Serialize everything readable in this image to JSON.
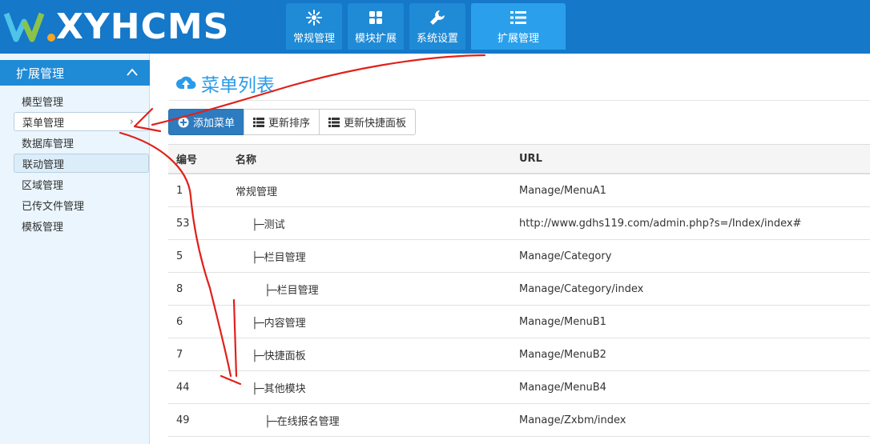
{
  "logo": {
    "text": "XYHCMS"
  },
  "nav": {
    "items": [
      {
        "label": "常规管理",
        "icon": "gear-icon"
      },
      {
        "label": "模块扩展",
        "icon": "grid-icon"
      },
      {
        "label": "系统设置",
        "icon": "wrench-icon"
      },
      {
        "label": "扩展管理",
        "icon": "list-icon"
      }
    ]
  },
  "sidebar": {
    "header": "扩展管理",
    "items": [
      {
        "label": "模型管理"
      },
      {
        "label": "菜单管理"
      },
      {
        "label": "数据库管理"
      },
      {
        "label": "联动管理"
      },
      {
        "label": "区域管理"
      },
      {
        "label": "已传文件管理"
      },
      {
        "label": "模板管理"
      }
    ],
    "arrow": "›"
  },
  "main": {
    "title": "菜单列表",
    "toolbar": {
      "add": "添加菜单",
      "sort": "更新排序",
      "quick": "更新快捷面板"
    },
    "table": {
      "headers": [
        "编号",
        "名称",
        "URL"
      ],
      "rows": [
        {
          "id": "1",
          "name": "常规管理",
          "url": "Manage/MenuA1"
        },
        {
          "id": "53",
          "name": "├─测试",
          "url": "http://www.gdhs119.com/admin.php?s=/Index/index#"
        },
        {
          "id": "5",
          "name": "├─栏目管理",
          "url": "Manage/Category"
        },
        {
          "id": "8",
          "name": "├─栏目管理",
          "url": "Manage/Category/index"
        },
        {
          "id": "6",
          "name": "├─内容管理",
          "url": "Manage/MenuB1"
        },
        {
          "id": "7",
          "name": "├─快捷面板",
          "url": "Manage/MenuB2"
        },
        {
          "id": "44",
          "name": "├─其他模块",
          "url": "Manage/MenuB4"
        },
        {
          "id": "49",
          "name": "├─在线报名管理",
          "url": "Manage/Zxbm/index"
        }
      ]
    }
  },
  "colors": {
    "header": "#1578c9",
    "accent": "#2a9be8",
    "primary_button": "#2e7bbf",
    "annotation": "#e0201b"
  }
}
